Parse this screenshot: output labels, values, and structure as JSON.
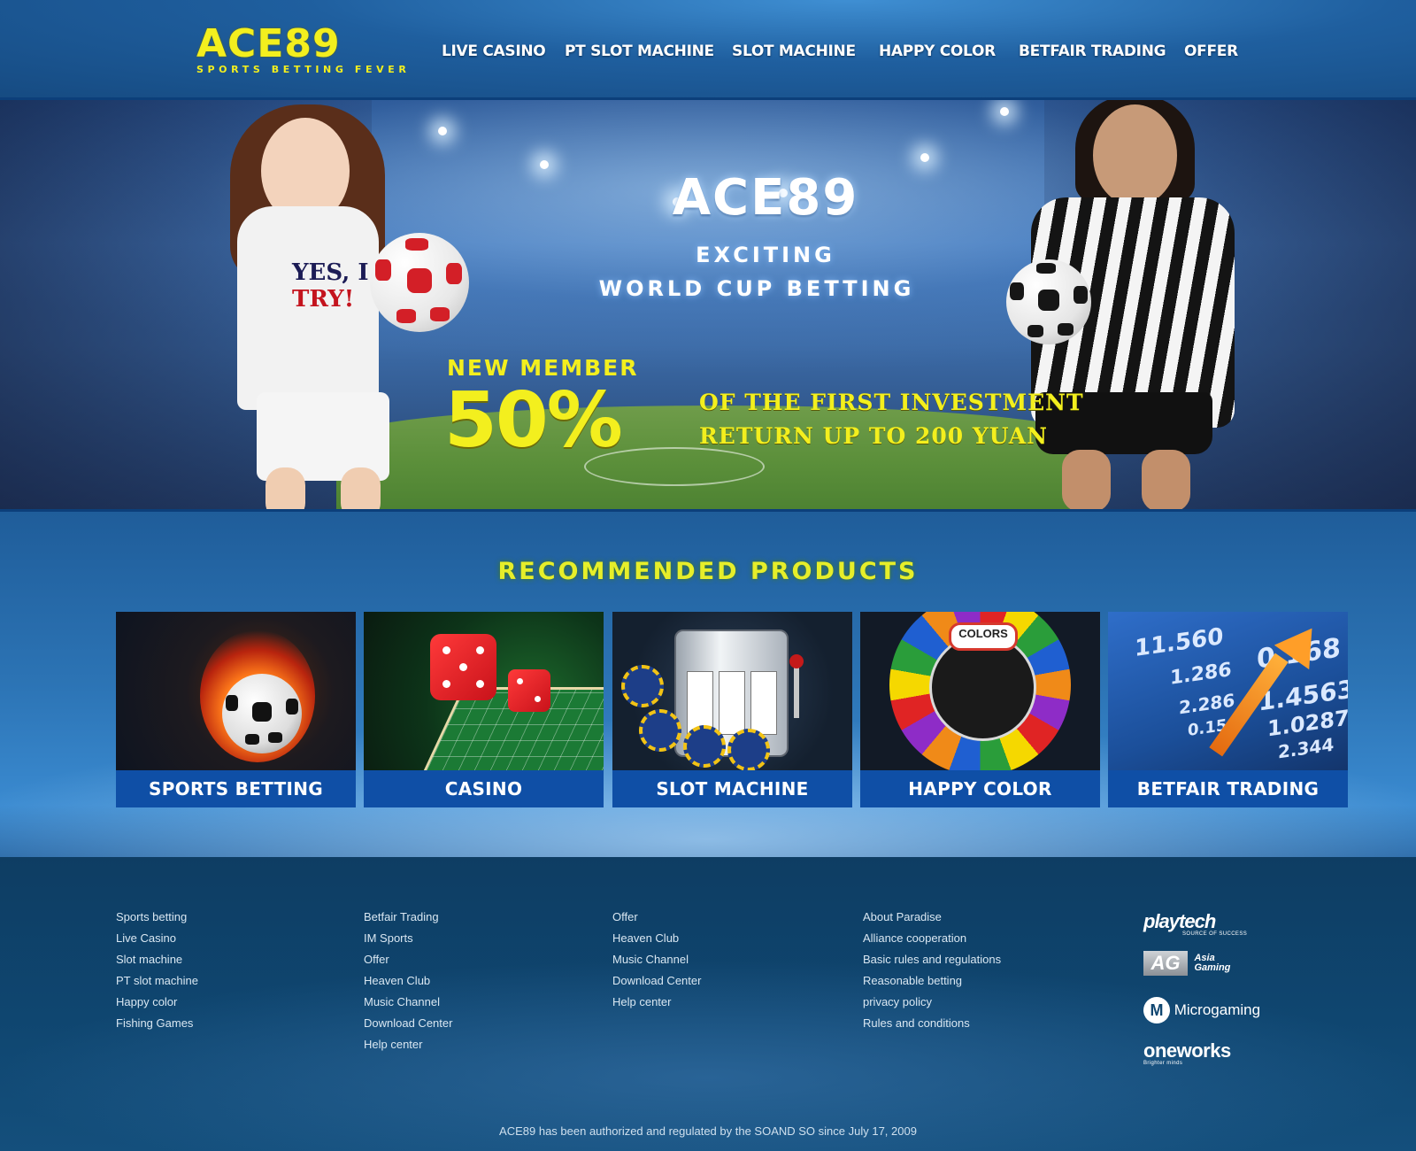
{
  "header": {
    "logo_main": "ACE89",
    "logo_sub": "SPORTS BETTING FEVER",
    "nav": [
      "LIVE CASINO",
      "PT SLOT MACHINE",
      "SLOT MACHINE",
      "HAPPY COLOR",
      "BETFAIR TRADING",
      "OFFER"
    ]
  },
  "hero": {
    "title": "ACE89",
    "subtitle_1": "EXCITING",
    "subtitle_2": "WORLD CUP BETTING",
    "new_member": "NEW MEMBER",
    "percent": "50%",
    "promo_line_1": "OF THE FIRST INVESTMENT",
    "promo_line_2": "RETURN UP TO 200 YUAN",
    "shirt_text_1": "YES, I",
    "shirt_text_2": "TRY!"
  },
  "products": {
    "title": "RECOMMENDED PRODUCTS",
    "cards": [
      {
        "label": "SPORTS BETTING"
      },
      {
        "label": "CASINO"
      },
      {
        "label": "SLOT MACHINE"
      },
      {
        "label": "HAPPY COLOR"
      },
      {
        "label": "BETFAIR TRADING"
      }
    ],
    "slot_colors_badge": "COLORS",
    "betfair_numbers": [
      "11.560",
      "1.286",
      "2.286",
      "0.156",
      "0.168",
      "1.4563",
      "1.0287",
      "2.344"
    ]
  },
  "footer": {
    "columns": [
      [
        "Sports betting",
        "Live Casino",
        "Slot machine",
        "PT slot machine",
        "Happy color",
        "Fishing Games"
      ],
      [
        "Betfair Trading",
        "IM Sports",
        "Offer",
        "Heaven Club",
        "Music Channel",
        "Download Center",
        "Help center"
      ],
      [
        "Offer",
        "Heaven Club",
        "Music Channel",
        "Download Center",
        "Help center"
      ],
      [
        "About Paradise",
        "Alliance cooperation",
        "Basic rules and regulations",
        "Reasonable betting",
        "privacy policy",
        "Rules and conditions"
      ]
    ],
    "partners": {
      "playtech": "playtech",
      "playtech_sub": "SOURCE OF SUCCESS",
      "ag": "AG",
      "ag_sub": "Asia Gaming",
      "microgaming": "Microgaming",
      "oneworks": "oneworks",
      "oneworks_sub": "Brighter minds"
    },
    "copyright": "ACE89 has been authorized and regulated by the SOAND SO since July 17, 2009"
  },
  "colors": {
    "brand_yellow": "#f3ef1e",
    "nav_bar": "#1f5f9f",
    "card_label_bg": "#0f4fa6",
    "footer_bg": "#0e3d63"
  }
}
